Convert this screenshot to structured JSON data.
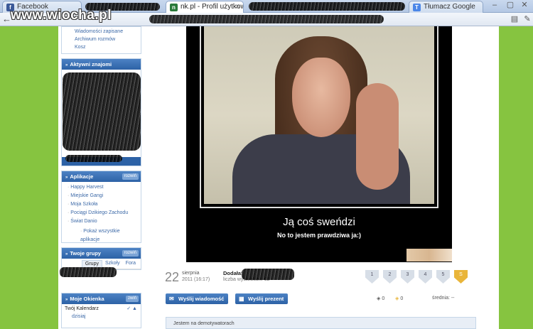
{
  "browser": {
    "tabs": [
      {
        "label": "Facebook",
        "favicon": "facebook-icon",
        "color": "#3b5998"
      },
      {
        "label": "nk.pl - Profil użytkow",
        "favicon": "nk-icon",
        "color": "#2a7a3a"
      },
      {
        "label": "Tłumacz Google",
        "favicon": "translate-icon",
        "color": "#4a86e8"
      }
    ],
    "back_glyph": "←"
  },
  "watermark": "www.wiocha.pl",
  "sidebar": {
    "messages": [
      "Wiadomości zapisane",
      "Archiwum rozmów",
      "Kosz"
    ],
    "active_friends_title": "Aktywni znajomi",
    "apps_title": "Aplikacje",
    "apps_toggle": "rozwiń",
    "apps": [
      "Happy Harvest",
      "Miejskie Gangi",
      "Moja Szkoła",
      "Pociągi Dzikiego Zachodu",
      "Świat Danio"
    ],
    "apps_show_all": "Pokaż wszystkie aplikacje",
    "groups_title": "Twoje grupy",
    "groups_toggle": "rozwiń",
    "groups_tabs": [
      "Grupy",
      "Szkoły",
      "Fora"
    ],
    "widgets_title": "Moje Okienka",
    "widgets_toggle": "zwiń",
    "calendar_label": "Twój Kalendarz",
    "today_label": "dzisiaj"
  },
  "poster": {
    "title": "Ją coś sweńdzi",
    "subtitle": "No to jestem prawdziwa ja:)"
  },
  "info": {
    "day": "22",
    "month": "sierpnia",
    "time": "2011 (16:17)",
    "added_label": "Dodała:",
    "views_label": "liczba wyświetleń: 62",
    "ratings": [
      "1",
      "2",
      "3",
      "4",
      "5",
      "S"
    ]
  },
  "actions": {
    "send_message": "Wyślij wiadomość",
    "send_gift": "Wyślij prezent",
    "count_a": "0",
    "count_b": "0",
    "average_label": "średnia: --"
  },
  "footer": {
    "text": "Jestem na demotywatorach"
  }
}
